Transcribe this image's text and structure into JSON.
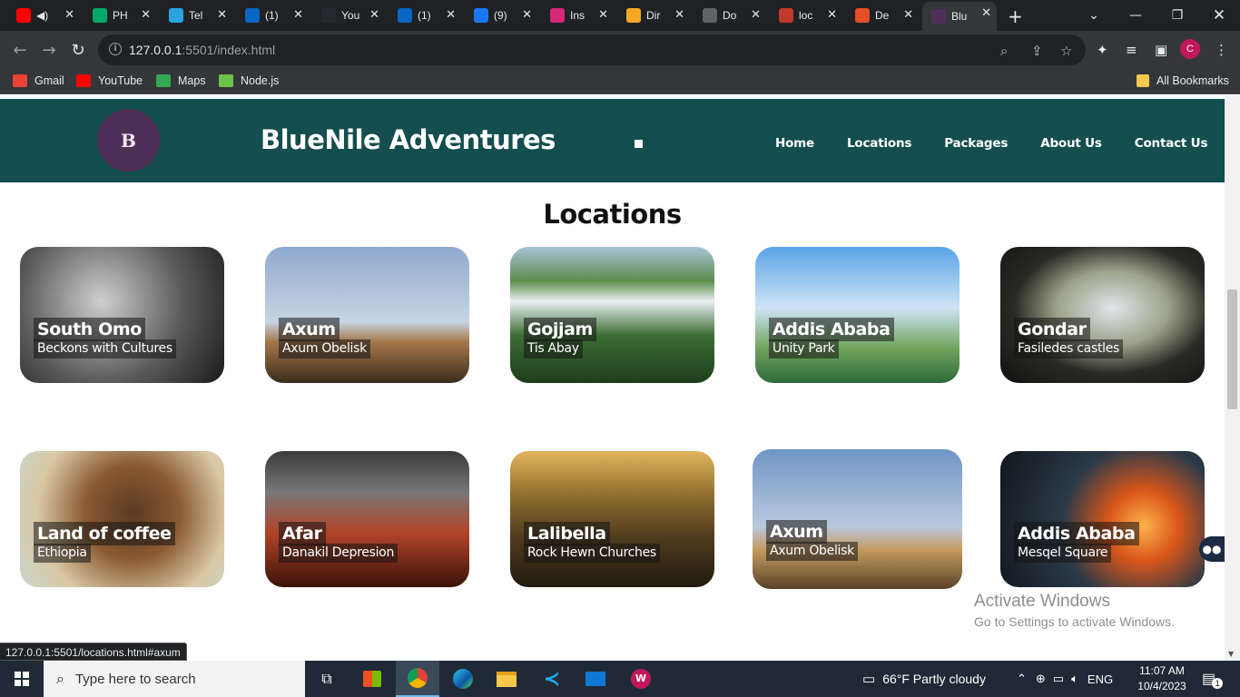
{
  "browser": {
    "tabs": [
      {
        "label": "",
        "icon": "youtube-icon",
        "color": "#ff0000"
      },
      {
        "label": "PH",
        "icon": "w-icon",
        "color": "#00a86b"
      },
      {
        "label": "Tel",
        "icon": "telegram-icon",
        "color": "#2aa3df"
      },
      {
        "label": "(1)",
        "icon": "linkedin-icon",
        "color": "#0a66c2"
      },
      {
        "label": "You",
        "icon": "github-icon",
        "color": "#24292e"
      },
      {
        "label": "(1)",
        "icon": "linkedin-icon",
        "color": "#0a66c2"
      },
      {
        "label": "(9)",
        "icon": "facebook-icon",
        "color": "#1877f2"
      },
      {
        "label": "Ins",
        "icon": "instagram-icon",
        "color": "#d62976"
      },
      {
        "label": "Dir",
        "icon": "firebase-icon",
        "color": "#f5a623"
      },
      {
        "label": "Do",
        "icon": "download-icon",
        "color": "#5f6368"
      },
      {
        "label": "loc",
        "icon": "kenya-icon",
        "color": "#c0392b"
      },
      {
        "label": "De",
        "icon": "html-icon",
        "color": "#e44d26"
      },
      {
        "label": "Blu",
        "icon": "site-logo-icon",
        "color": "#4f2f58"
      }
    ],
    "url_host": "127.0.0.1",
    "url_path": ":5501/index.html",
    "bookmarks": [
      {
        "label": "Gmail",
        "color": "#ea4335"
      },
      {
        "label": "YouTube",
        "color": "#ff0000"
      },
      {
        "label": "Maps",
        "color": "#34a853"
      },
      {
        "label": "Node.js",
        "color": "#6cc24a"
      }
    ],
    "all_bookmarks": "All Bookmarks",
    "profile_initial": "C",
    "status_url": "127.0.0.1:5501/locations.html#axum"
  },
  "site": {
    "logo_text": "B",
    "brand": "BlueNile Adventures",
    "nav": [
      "Home",
      "Locations",
      "Packages",
      "About Us",
      "Contact Us"
    ],
    "section_title": "Locations",
    "header_color": "#144e4e",
    "cards": [
      {
        "title": "South Omo",
        "subtitle": "Beckons with Cultures"
      },
      {
        "title": "Axum",
        "subtitle": "Axum Obelisk"
      },
      {
        "title": "Gojjam",
        "subtitle": "Tis Abay"
      },
      {
        "title": "Addis Ababa",
        "subtitle": "Unity Park"
      },
      {
        "title": "Gondar",
        "subtitle": "Fasiledes castles"
      },
      {
        "title": "Land of coffee",
        "subtitle": "Ethiopia"
      },
      {
        "title": "Afar",
        "subtitle": "Danakil Depresion"
      },
      {
        "title": "Lalibella",
        "subtitle": "Rock Hewn Churches"
      },
      {
        "title": "Axum",
        "subtitle": "Axum Obelisk"
      },
      {
        "title": "Addis Ababa",
        "subtitle": "Mesqel Square"
      }
    ]
  },
  "watermark": {
    "line1": "Activate Windows",
    "line2": "Go to Settings to activate Windows."
  },
  "taskbar": {
    "search_placeholder": "Type here to search",
    "weather": "66°F  Partly cloudy",
    "language": "ENG",
    "time": "11:07 AM",
    "date": "10/4/2023",
    "notification_count": "1"
  }
}
